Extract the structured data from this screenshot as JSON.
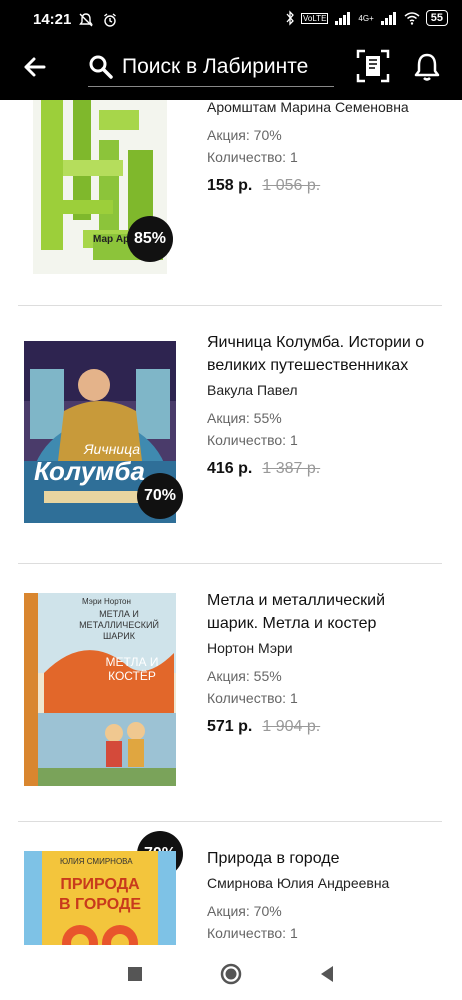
{
  "status": {
    "time": "14:21",
    "network": "4G+",
    "volte": "VoLTE",
    "battery": "55"
  },
  "header": {
    "search_placeholder": "Поиск в Лабиринте"
  },
  "items": [
    {
      "author": "Аромштам Марина Семеновна",
      "promo": "Акция: 70%",
      "qty": "Количество: 1",
      "price": "158 р.",
      "old_price": "1 056 р.",
      "discount": "85%",
      "cover_text": "Мар Аромш"
    },
    {
      "title": "Яичница Колумба. Истории о великих путешественниках",
      "author": "Вакула Павел",
      "promo": "Акция: 55%",
      "qty": "Количество: 1",
      "price": "416 р.",
      "old_price": "1 387 р.",
      "discount": "70%",
      "cover_text": "Колумба",
      "cover_top": "Яичница"
    },
    {
      "title": "Метла и металлический шарик. Метла и костер",
      "author": "Нортон Мэри",
      "promo": "Акция: 55%",
      "qty": "Количество: 1",
      "price": "571 р.",
      "old_price": "1 904 р.",
      "discount": "70%",
      "cover_author": "Мэри Нортон",
      "cover_title": "МЕТЛА И МЕТАЛЛИЧЕСКИЙ ШАРИК",
      "cover_sub": "МЕТЛА И КОСТЁР"
    },
    {
      "title": "Природа в городе",
      "author": "Смирнова Юлия Андреевна",
      "promo": "Акция: 70%",
      "qty": "Количество: 1",
      "cover_author": "ЮЛИЯ СМИРНОВА",
      "cover_title": "ПРИРОДА В ГОРОДЕ"
    }
  ],
  "colors": {
    "topbar": "#000000",
    "badge": "#111111",
    "separator": "#dddddd"
  }
}
